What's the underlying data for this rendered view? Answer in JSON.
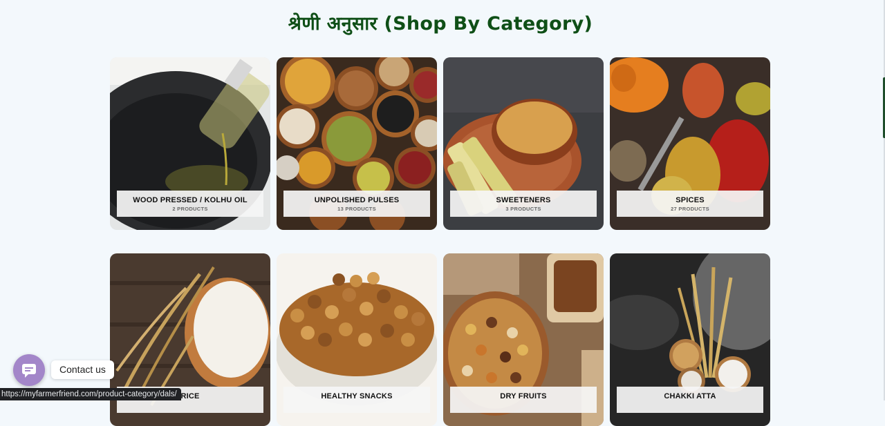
{
  "page": {
    "title": "श्रेणी अनुसार (Shop By Category)"
  },
  "categories": [
    {
      "name": "WOOD PRESSED / KOLHU OIL",
      "count": "2 PRODUCTS"
    },
    {
      "name": "UNPOLISHED PULSES",
      "count": "13 PRODUCTS"
    },
    {
      "name": "SWEETENERS",
      "count": "3 PRODUCTS"
    },
    {
      "name": "SPICES",
      "count": "27 PRODUCTS"
    },
    {
      "name": "RICE",
      "count": ""
    },
    {
      "name": "HEALTHY SNACKS",
      "count": ""
    },
    {
      "name": "DRY FRUITS",
      "count": ""
    },
    {
      "name": "CHAKKI ATTA",
      "count": ""
    }
  ],
  "contact": {
    "label": "Contact us",
    "icon": "chat-bubble-icon"
  },
  "status_bar": {
    "url": "https://myfarmerfriend.com/product-category/dals/"
  }
}
